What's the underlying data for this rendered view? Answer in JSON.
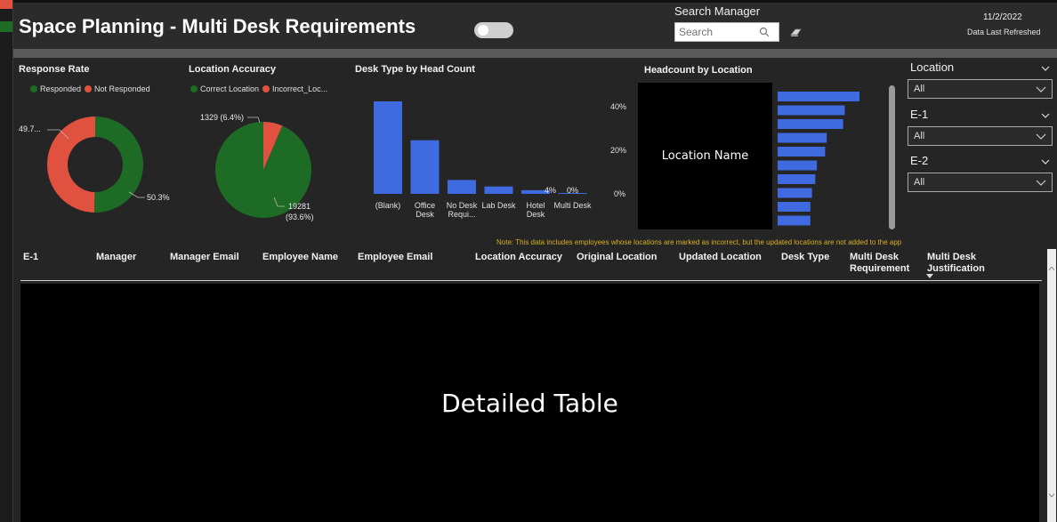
{
  "header": {
    "title": "Space Planning - Multi Desk Requirements",
    "search_label": "Search Manager",
    "search_placeholder": "Search",
    "date": "11/2/2022",
    "refreshed_label": "Data Last Refreshed"
  },
  "colors": {
    "background": "#252525",
    "green": "#1d6b25",
    "red": "#e0523f",
    "bar_blue": "#3f6ae0",
    "note_yellow": "#d8b020"
  },
  "response_rate": {
    "title": "Response Rate",
    "legend": [
      "Responded",
      "Not Responded"
    ],
    "chart_data": {
      "type": "pie",
      "labels": [
        "Responded",
        "Not Responded"
      ],
      "values": [
        50.3,
        49.7
      ],
      "value_labels": [
        "50.3%",
        "49.7..."
      ]
    }
  },
  "location_accuracy": {
    "title": "Location Accuracy",
    "legend": [
      "Correct Location",
      "Incorrect_Loc..."
    ],
    "chart_data": {
      "type": "pie",
      "labels": [
        "Correct Location",
        "Incorrect_Loc..."
      ],
      "values": [
        19281,
        1329
      ],
      "value_labels": [
        "19281",
        "(93.6%)",
        "1329 (6.4%)"
      ]
    }
  },
  "desk_type": {
    "title": "Desk Type by Head Count",
    "chart_data": {
      "type": "bar",
      "categories": [
        "(Blank)",
        "Office Desk",
        "No Desk Requi...",
        "Lab Desk",
        "Hotel Desk",
        "Multi Desk"
      ],
      "values": [
        100,
        58,
        15,
        8,
        4,
        0
      ],
      "data_labels": [
        "",
        "",
        "",
        "",
        "4%",
        "0%"
      ]
    }
  },
  "headcount_location": {
    "title": "Headcount by Location",
    "placeholder": "Location Name",
    "chart_data": {
      "type": "bar",
      "orientation": "horizontal",
      "y_ticks": [
        "40%",
        "20%",
        "0%"
      ],
      "values": [
        100,
        82,
        80,
        60,
        58,
        48,
        46,
        42,
        40,
        40
      ]
    }
  },
  "note": "Note: This data includes employees whose locations are marked as incorrect, but the updated locations are not added to the app",
  "slicers": [
    {
      "title": "Location",
      "value": "All"
    },
    {
      "title": "E-1",
      "value": "All"
    },
    {
      "title": "E-2",
      "value": "All"
    }
  ],
  "table": {
    "columns": [
      "E-1",
      "Manager",
      "Manager Email",
      "Employee Name",
      "Employee Email",
      "Location Accuracy",
      "Original Location",
      "Updated Location",
      "Desk Type",
      "Multi Desk Requirement",
      "Multi Desk Justification"
    ],
    "placeholder": "Detailed Table"
  }
}
